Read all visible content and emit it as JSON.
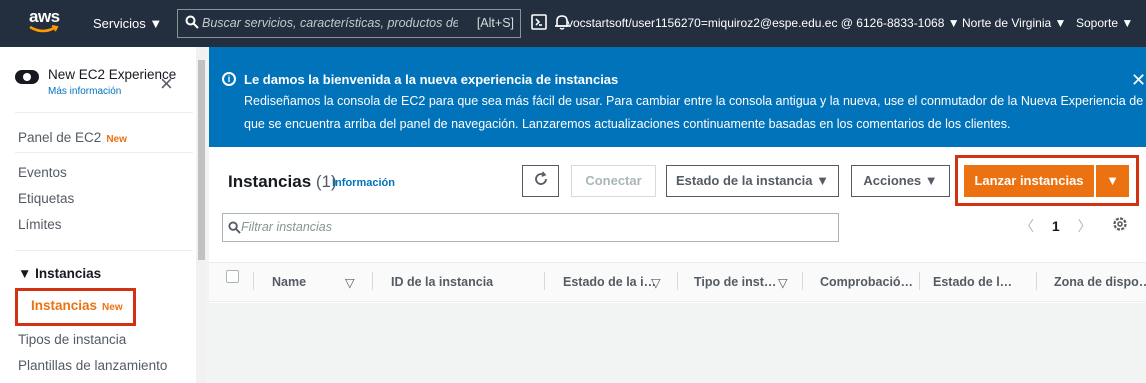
{
  "topbar": {
    "logo": "aws",
    "services_label": "Servicios ▼",
    "search_placeholder": "Buscar servicios, características, productos del Mc",
    "search_shortcut": "[Alt+S]",
    "account": "vocstartsoft/user1156270=miquiroz2@espe.edu.ec @ 6126-8833-1068 ▼",
    "region": "Norte de Virginia ▼",
    "support": "Soporte ▼"
  },
  "sidebar": {
    "new_experience": "New EC2 Experience",
    "more_info": "Más información",
    "panel_label": "Panel de EC2",
    "new_badge": "New",
    "items": [
      "Eventos",
      "Etiquetas",
      "Límites"
    ],
    "section": "▼ Instancias",
    "active_item": "Instancias",
    "active_badge": "New",
    "sub_items": [
      "Tipos de instancia",
      "Plantillas de lanzamiento"
    ]
  },
  "banner": {
    "title": "Le damos la bienvenida a la nueva experiencia de instancias",
    "lines": [
      "Rediseñamos la consola de EC2 para que sea más fácil de usar. Para cambiar entre la consola antigua y la nueva, use el conmutador de la Nueva Experiencia de EC2",
      "que se encuentra arriba del panel de navegación. Lanzaremos actualizaciones continuamente basadas en los comentarios de los clientes."
    ]
  },
  "instances": {
    "title": "Instancias",
    "count": "(1)",
    "info": "Información",
    "connect": "Conectar",
    "state": "Estado de la instancia ▼",
    "actions": "Acciones ▼",
    "launch": "Lanzar instancias",
    "launch_arrow": "▼",
    "filter_placeholder": "Filtrar instancias",
    "page": "1",
    "columns": [
      "Name",
      "ID de la instancia",
      "Estado de la i…",
      "Tipo de inst…",
      "Comprobació…",
      "Estado de l…",
      "Zona de dispo…"
    ]
  },
  "colors": {
    "topbar": "#232f3e",
    "banner": "#0073bb",
    "primary": "#ec7211",
    "highlight": "#d13212"
  }
}
